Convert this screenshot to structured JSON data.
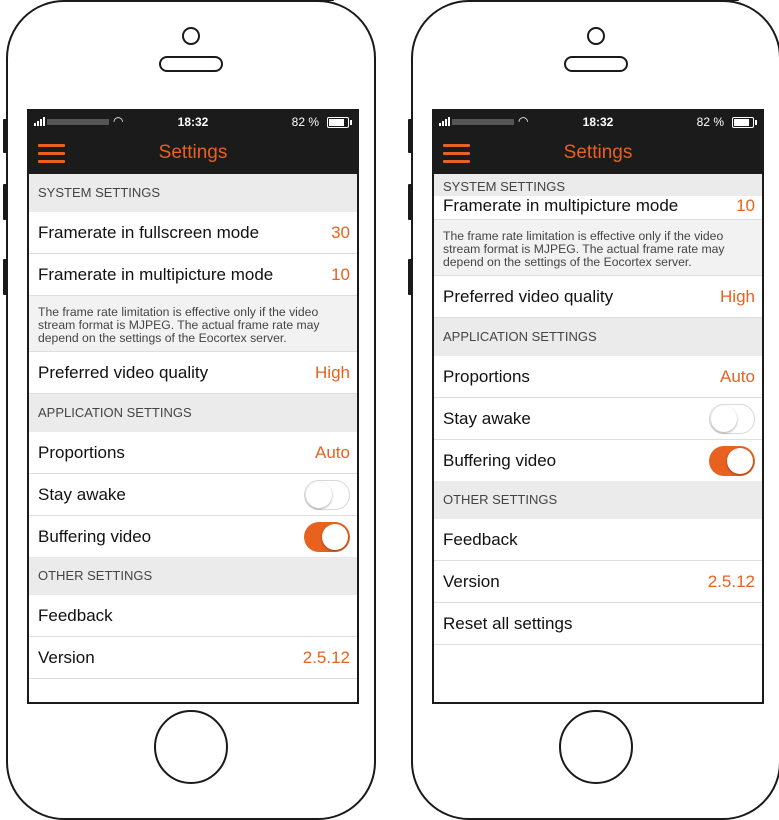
{
  "accent_color": "#e8611f",
  "screens": [
    {
      "status": {
        "time": "18:32",
        "battery": "82 %"
      },
      "nav": {
        "title": "Settings",
        "menu_icon": "hamburger-menu-icon"
      },
      "system_section": "SYSTEM SETTINGS",
      "framerate_fullscreen": {
        "label": "Framerate in fullscreen mode",
        "value": "30"
      },
      "framerate_multipicture": {
        "label": "Framerate in multipicture mode",
        "value": "10"
      },
      "framerate_note": "The frame rate limitation is effective only if the video stream format is MJPEG. The actual frame rate may depend on the settings of the Eocortex server.",
      "video_quality": {
        "label": "Preferred video quality",
        "value": "High"
      },
      "application_section": "APPLICATION SETTINGS",
      "proportions": {
        "label": "Proportions",
        "value": "Auto"
      },
      "stay_awake": {
        "label": "Stay awake",
        "on": false
      },
      "buffering": {
        "label": "Buffering video",
        "on": true
      },
      "other_section": "OTHER SETTINGS",
      "feedback": {
        "label": "Feedback"
      },
      "version": {
        "label": "Version",
        "value": "2.5.12"
      }
    },
    {
      "status": {
        "time": "18:32",
        "battery": "82 %"
      },
      "nav": {
        "title": "Settings",
        "menu_icon": "hamburger-menu-icon"
      },
      "system_section": "SYSTEM SETTINGS",
      "framerate_multipicture": {
        "label": "Framerate in multipicture mode",
        "value": "10"
      },
      "framerate_note": "The frame rate limitation is effective only if the video stream format is MJPEG. The actual frame rate may depend on the settings of the Eocortex server.",
      "video_quality": {
        "label": "Preferred video quality",
        "value": "High"
      },
      "application_section": "APPLICATION SETTINGS",
      "proportions": {
        "label": "Proportions",
        "value": "Auto"
      },
      "stay_awake": {
        "label": "Stay awake",
        "on": false
      },
      "buffering": {
        "label": "Buffering video",
        "on": true
      },
      "other_section": "OTHER SETTINGS",
      "feedback": {
        "label": "Feedback"
      },
      "version": {
        "label": "Version",
        "value": "2.5.12"
      },
      "reset": {
        "label": "Reset all settings"
      }
    }
  ]
}
